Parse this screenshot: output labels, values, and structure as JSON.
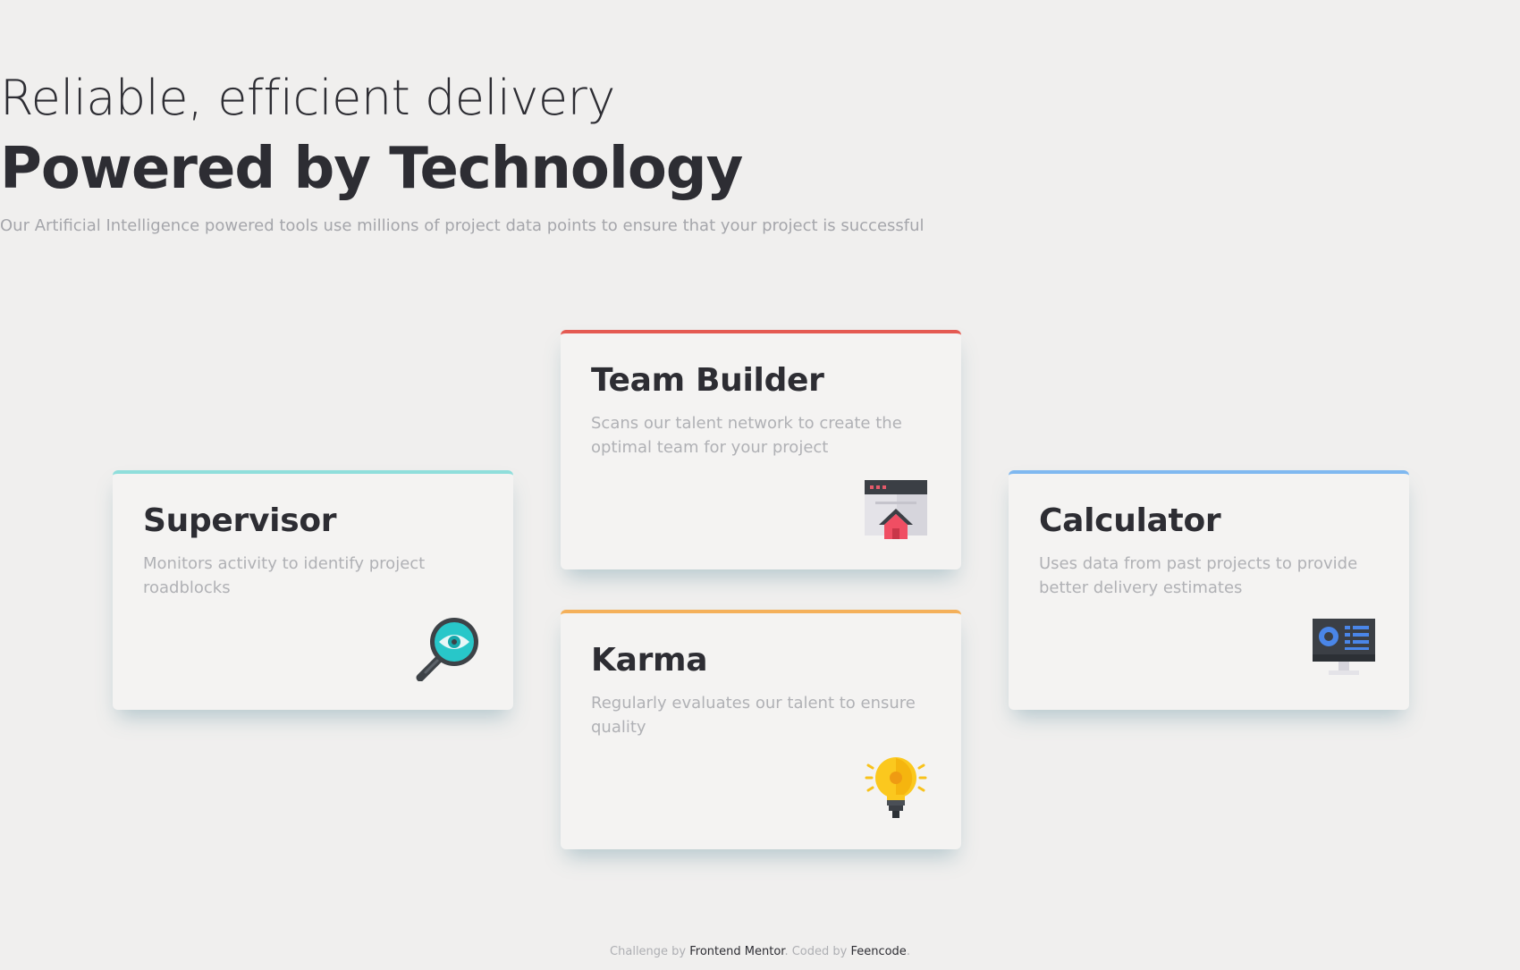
{
  "header": {
    "title_light": "Reliable, efficient delivery",
    "title_bold": "Powered by Technology",
    "subtitle": "Our Artificial Intelligence powered tools use millions of project data points to ensure that your project is successful"
  },
  "cards": {
    "supervisor": {
      "title": "Supervisor",
      "description": "Monitors activity to identify project roadblocks",
      "accent": "#8fdedb",
      "icon": "magnifier-eye-icon"
    },
    "team_builder": {
      "title": "Team Builder",
      "description": "Scans our talent network to create the optimal team for your project",
      "accent": "#e45a52",
      "icon": "browser-home-icon"
    },
    "karma": {
      "title": "Karma",
      "description": "Regularly evaluates our talent to ensure quality",
      "accent": "#f4b05a",
      "icon": "lightbulb-icon"
    },
    "calculator": {
      "title": "Calculator",
      "description": "Uses data from past projects to provide better delivery estimates",
      "accent": "#7fb8f0",
      "icon": "monitor-chart-icon"
    }
  },
  "footer": {
    "prefix": "Challenge by",
    "challenge_link": "Frontend Mentor",
    "middle": ". Coded by",
    "coder_link": "Feencode",
    "suffix": "."
  }
}
